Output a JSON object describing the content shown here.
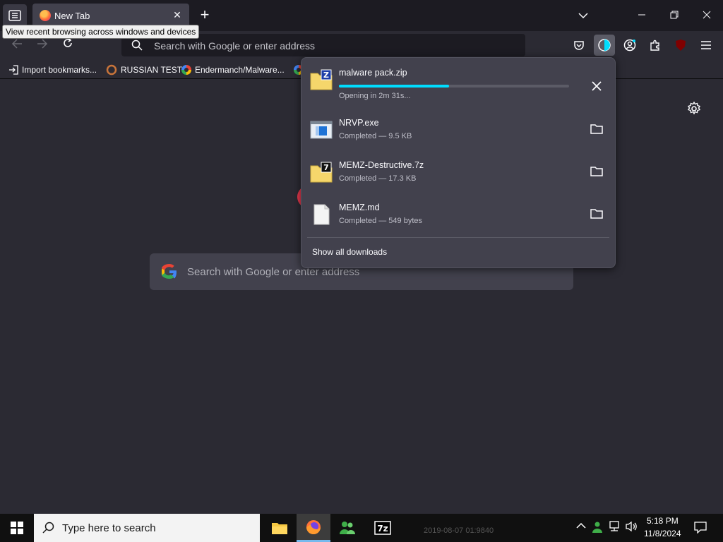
{
  "tabstrip": {
    "tab_title": "New Tab",
    "tab_close": "✕",
    "new_tab": "+"
  },
  "tooltip": "View recent browsing across windows and devices",
  "navbar": {
    "url_placeholder": "Search with Google or enter address"
  },
  "bookmarks": [
    {
      "label": "Import bookmarks...",
      "icon": "import-icon"
    },
    {
      "label": "RUSSIAN TEST",
      "icon": "bookmark-favicon"
    },
    {
      "label": "Endermanch/Malware...",
      "icon": "google-icon"
    }
  ],
  "page": {
    "search_placeholder": "Search with Google or enter address"
  },
  "downloads": {
    "items": [
      {
        "name": "malware pack.zip",
        "status": "Opening in 2m 31s...",
        "progress": 0.48,
        "icon": "zip-archive-icon"
      },
      {
        "name": "NRVP.exe",
        "status": "Completed — 9.5 KB",
        "icon": "exe-icon"
      },
      {
        "name": "MEMZ-Destructive.7z",
        "status": "Completed — 17.3 KB",
        "icon": "7z-archive-icon"
      },
      {
        "name": "MEMZ.md",
        "status": "Completed — 549 bytes",
        "icon": "document-icon"
      }
    ],
    "show_all": "Show all downloads"
  },
  "taskbar": {
    "search_placeholder": "Type here to search",
    "time": "5:18 PM",
    "date": "11/8/2024",
    "background_text": "2019-08-07 01:9840"
  },
  "colors": {
    "accent": "#00ddff",
    "panel": "#42414d",
    "toolbar": "#2b2a33",
    "tabstrip": "#1c1b22"
  }
}
